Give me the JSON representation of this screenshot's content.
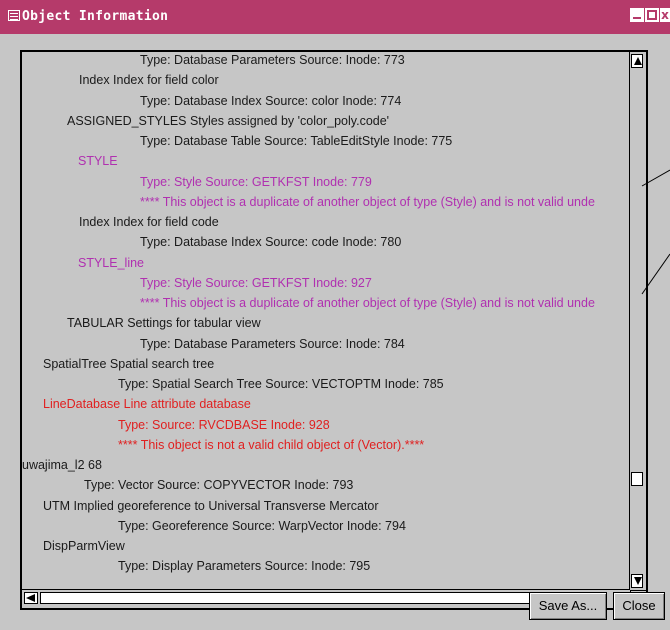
{
  "window": {
    "title": "Object Information"
  },
  "content": {
    "lines": [
      {
        "text": "Type: Database Parameters  Source:                  Inode: 773",
        "indent": 118,
        "color": "black"
      },
      {
        "text": "Index        Index for field color",
        "indent": 57,
        "color": "black"
      },
      {
        "text": "Type: Database Index  Source: color         Inode: 774",
        "indent": 118,
        "color": "black"
      },
      {
        "text": "ASSIGNED_STYLES  Styles assigned by 'color_poly.code'",
        "indent": 45,
        "color": "black"
      },
      {
        "text": "Type: Database Table  Source: TableEditStyle    Inode: 775",
        "indent": 118,
        "color": "black"
      },
      {
        "text": "STYLE",
        "indent": 56,
        "color": "magenta"
      },
      {
        "text": "Type: Style    Source: GETKFST          Inode: 779",
        "indent": 118,
        "color": "magenta"
      },
      {
        "text": "**** This object is a duplicate of another object of type (Style) and is not valid unde",
        "indent": 118,
        "color": "magenta"
      },
      {
        "text": "Index        Index for field code",
        "indent": 57,
        "color": "black"
      },
      {
        "text": "Type: Database Index  Source: code           Inode: 780",
        "indent": 118,
        "color": "black"
      },
      {
        "text": "STYLE_line",
        "indent": 56,
        "color": "magenta"
      },
      {
        "text": "Type: Style    Source: GETKFST          Inode: 927",
        "indent": 118,
        "color": "magenta"
      },
      {
        "text": "**** This object is a duplicate of another object of type (Style) and is not valid unde",
        "indent": 118,
        "color": "magenta"
      },
      {
        "text": "TABULAR        Settings for tabular view",
        "indent": 45,
        "color": "black"
      },
      {
        "text": "Type: Database Parameters  Source:                   Inode: 784",
        "indent": 118,
        "color": "black"
      },
      {
        "text": "SpatialTree     Spatial search tree",
        "indent": 21,
        "color": "black"
      },
      {
        "text": "Type: Spatial Search Tree  Source: VECTOPTM        Inode: 785",
        "indent": 96,
        "color": "black"
      },
      {
        "text": "LineDatabase    Line attribute database",
        "indent": 21,
        "color": "red"
      },
      {
        "text": "Type:              Source: RVCDBASE          Inode: 928",
        "indent": 96,
        "color": "red"
      },
      {
        "text": "**** This object is not a valid child object of (Vector).****",
        "indent": 96,
        "color": "red"
      },
      {
        "text": "uwajima_l2       68",
        "indent": 0,
        "color": "black"
      },
      {
        "text": "Type: Vector   Source: COPYVECTOR       Inode: 793",
        "indent": 62,
        "color": "black"
      },
      {
        "text": "UTM         Implied georeference to Universal Transverse Mercator",
        "indent": 21,
        "color": "black"
      },
      {
        "text": "Type: Georeference  Source: WarpVector       Inode: 794",
        "indent": 96,
        "color": "black"
      },
      {
        "text": "DispParmView",
        "indent": 21,
        "color": "black"
      },
      {
        "text": "Type: Display Parameters  Source:                  Inode: 795",
        "indent": 96,
        "color": "black"
      }
    ]
  },
  "buttons": {
    "save_as": "Save As...",
    "close": "Close"
  },
  "colors": {
    "title_bar": "#b53a6a",
    "magenta_text": "#b030b0",
    "red_text": "#e02020"
  }
}
